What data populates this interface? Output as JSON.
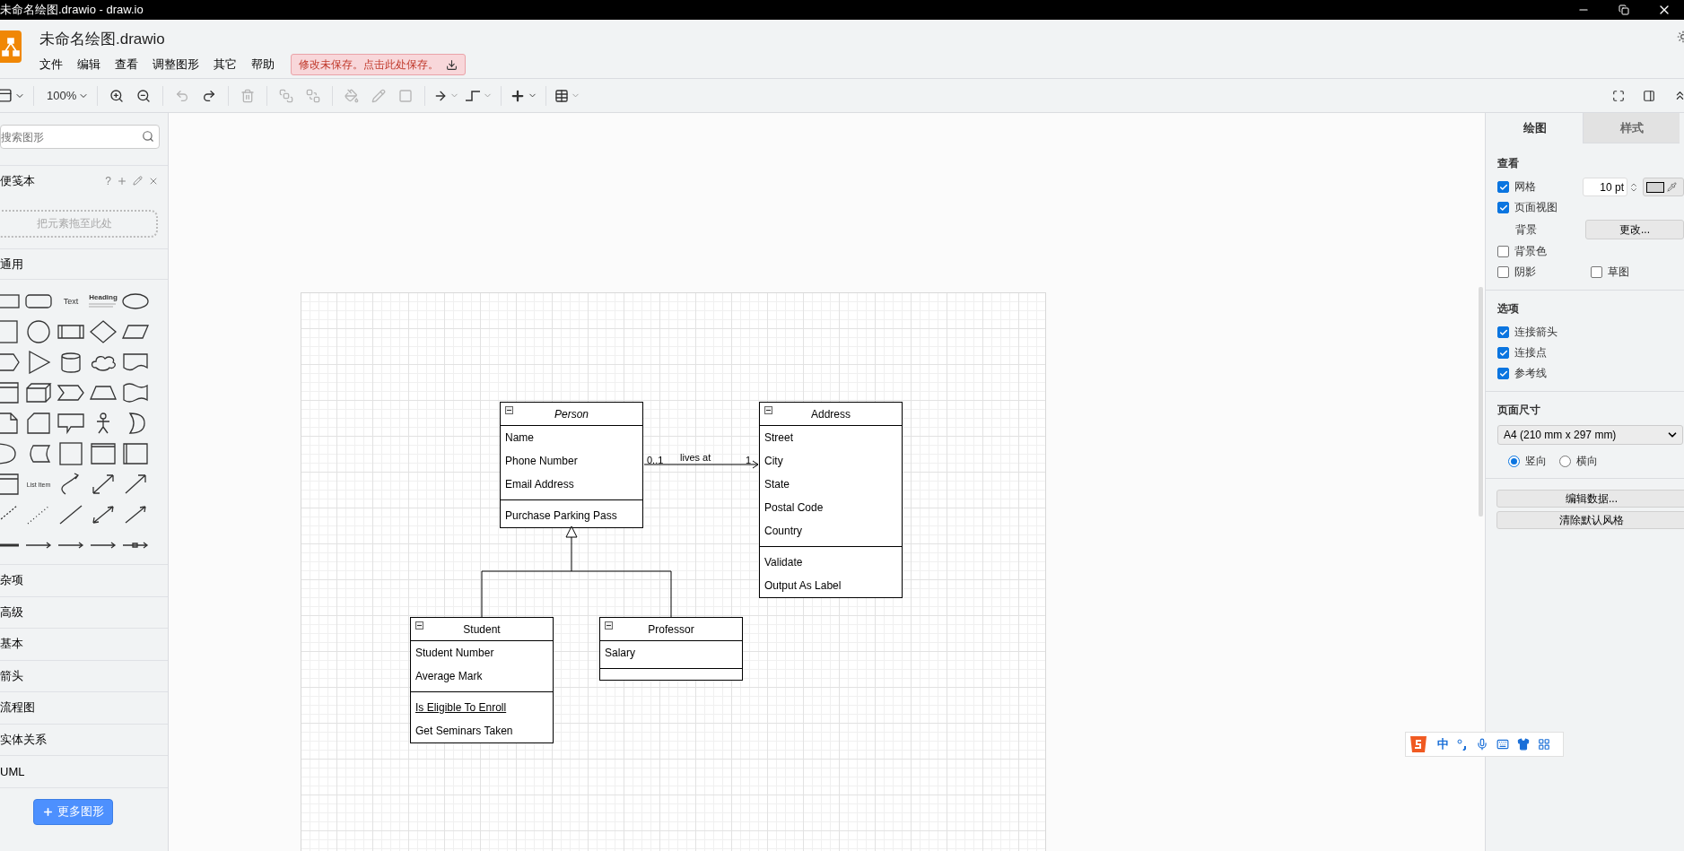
{
  "window": {
    "title": "未命名绘图.drawio - draw.io"
  },
  "header": {
    "file_name": "未命名绘图.drawio",
    "menu": [
      "文件",
      "编辑",
      "查看",
      "调整图形",
      "其它",
      "帮助"
    ],
    "save_notice": "修改未保存。点击此处保存。"
  },
  "toolbar": {
    "zoom": "100%"
  },
  "sidebar": {
    "search": {
      "placeholder": "搜索图形"
    },
    "scratchpad": {
      "title": "便笺本",
      "help": "?",
      "drop_hint": "把元素拖至此处"
    },
    "general": {
      "title": "通用",
      "text_shapes": [
        "Text",
        "Heading",
        "List Item"
      ]
    },
    "categories": [
      "杂项",
      "高级",
      "基本",
      "箭头",
      "流程图",
      "实体关系",
      "UML"
    ],
    "more_button": "更多图形"
  },
  "diagram": {
    "classes": [
      {
        "name": "Person",
        "abstract": true,
        "attributes": [
          "Name",
          "Phone Number",
          "Email Address"
        ],
        "operations": [
          {
            "text": "Purchase Parking Pass",
            "static": false
          }
        ]
      },
      {
        "name": "Address",
        "abstract": false,
        "attributes": [
          "Street",
          "City",
          "State",
          "Postal Code",
          "Country"
        ],
        "operations": [
          {
            "text": "Validate",
            "static": false
          },
          {
            "text": "Output As Label",
            "static": false
          }
        ]
      },
      {
        "name": "Student",
        "abstract": false,
        "attributes": [
          "Student Number",
          "Average Mark"
        ],
        "operations": [
          {
            "text": "Is Eligible To Enroll",
            "static": true
          },
          {
            "text": "Get Seminars Taken",
            "static": false
          }
        ]
      },
      {
        "name": "Professor",
        "abstract": false,
        "attributes": [
          "Salary"
        ]
      }
    ],
    "association": {
      "source_multiplicity": "0..1",
      "label": "lives at",
      "target_multiplicity": "1"
    }
  },
  "format_panel": {
    "tabs": [
      {
        "label": "绘图",
        "selected": true
      },
      {
        "label": "样式",
        "selected": false
      }
    ],
    "view": {
      "title": "查看",
      "grid": {
        "label": "网格",
        "checked": true,
        "size": "10 pt"
      },
      "page_view": {
        "label": "页面视图",
        "checked": true
      },
      "background": {
        "label": "背景",
        "button": "更改..."
      },
      "background_color": {
        "label": "背景色",
        "checked": false
      },
      "shadow": {
        "label": "阴影",
        "checked": false
      },
      "sketch": {
        "label": "草图",
        "checked": false
      }
    },
    "options": {
      "title": "选项",
      "items": [
        {
          "label": "连接箭头",
          "checked": true
        },
        {
          "label": "连接点",
          "checked": true
        },
        {
          "label": "参考线",
          "checked": true
        }
      ]
    },
    "paper_size": {
      "title": "页面尺寸",
      "value": "A4 (210 mm x 297 mm)",
      "orientations": [
        {
          "label": "竖向",
          "selected": true
        },
        {
          "label": "横向",
          "selected": false
        }
      ]
    },
    "buttons": [
      "编辑数据...",
      "清除默认风格"
    ]
  },
  "ime_toolbar": {
    "mode": "中"
  }
}
